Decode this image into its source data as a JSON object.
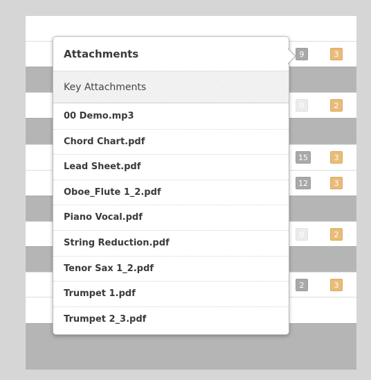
{
  "rows": [
    {
      "type": "white",
      "count": "",
      "secondary": ""
    },
    {
      "type": "white",
      "count": "9",
      "secondary": "3"
    },
    {
      "type": "gray",
      "count": "",
      "secondary": ""
    },
    {
      "type": "white",
      "count": "0",
      "secondary": "2"
    },
    {
      "type": "gray",
      "count": "",
      "secondary": ""
    },
    {
      "type": "white",
      "count": "15",
      "secondary": "3"
    },
    {
      "type": "white",
      "count": "12",
      "secondary": "3"
    },
    {
      "type": "gray",
      "count": "",
      "secondary": ""
    },
    {
      "type": "white",
      "count": "0",
      "secondary": "2"
    },
    {
      "type": "gray",
      "count": "",
      "secondary": ""
    },
    {
      "type": "white",
      "count": "2",
      "secondary": "3"
    },
    {
      "type": "gray",
      "count": "",
      "secondary": ""
    }
  ],
  "popover": {
    "title": "Attachments",
    "section_label": "Key Attachments",
    "files": [
      "00 Demo.mp3",
      "Chord Chart.pdf",
      "Lead Sheet.pdf",
      "Oboe_Flute 1_2.pdf",
      "Piano Vocal.pdf",
      "String Reduction.pdf",
      "Tenor Sax 1_2.pdf",
      "Trumpet 1.pdf",
      "Trumpet 2_3.pdf"
    ]
  },
  "colors": {
    "count_badge": "#a9a9a9",
    "empty_badge": "#ececec",
    "secondary_badge": "#e9bc78",
    "separator_row": "#b5b5b5"
  }
}
